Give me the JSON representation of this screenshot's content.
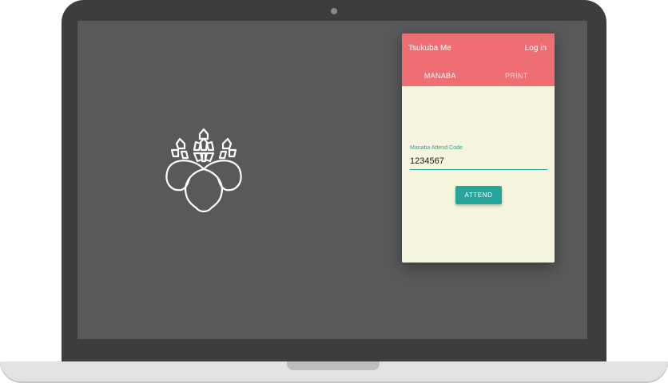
{
  "popup": {
    "title": "Tsukuba Me",
    "login_label": "Log in",
    "tabs": [
      {
        "label": "MANABA",
        "active": true
      },
      {
        "label": "PRINT",
        "active": false
      }
    ],
    "form": {
      "label": "Manaba Attend Code",
      "value": "1234567",
      "button_label": "ATTEND"
    }
  },
  "icons": {
    "logo": "paulownia-crest-icon"
  },
  "colors": {
    "header": "#ee6e73",
    "accent": "#26a69a",
    "panel_bg": "#f5f4dc",
    "screen_bg": "#58595b",
    "bezel": "#3d3d3d"
  }
}
